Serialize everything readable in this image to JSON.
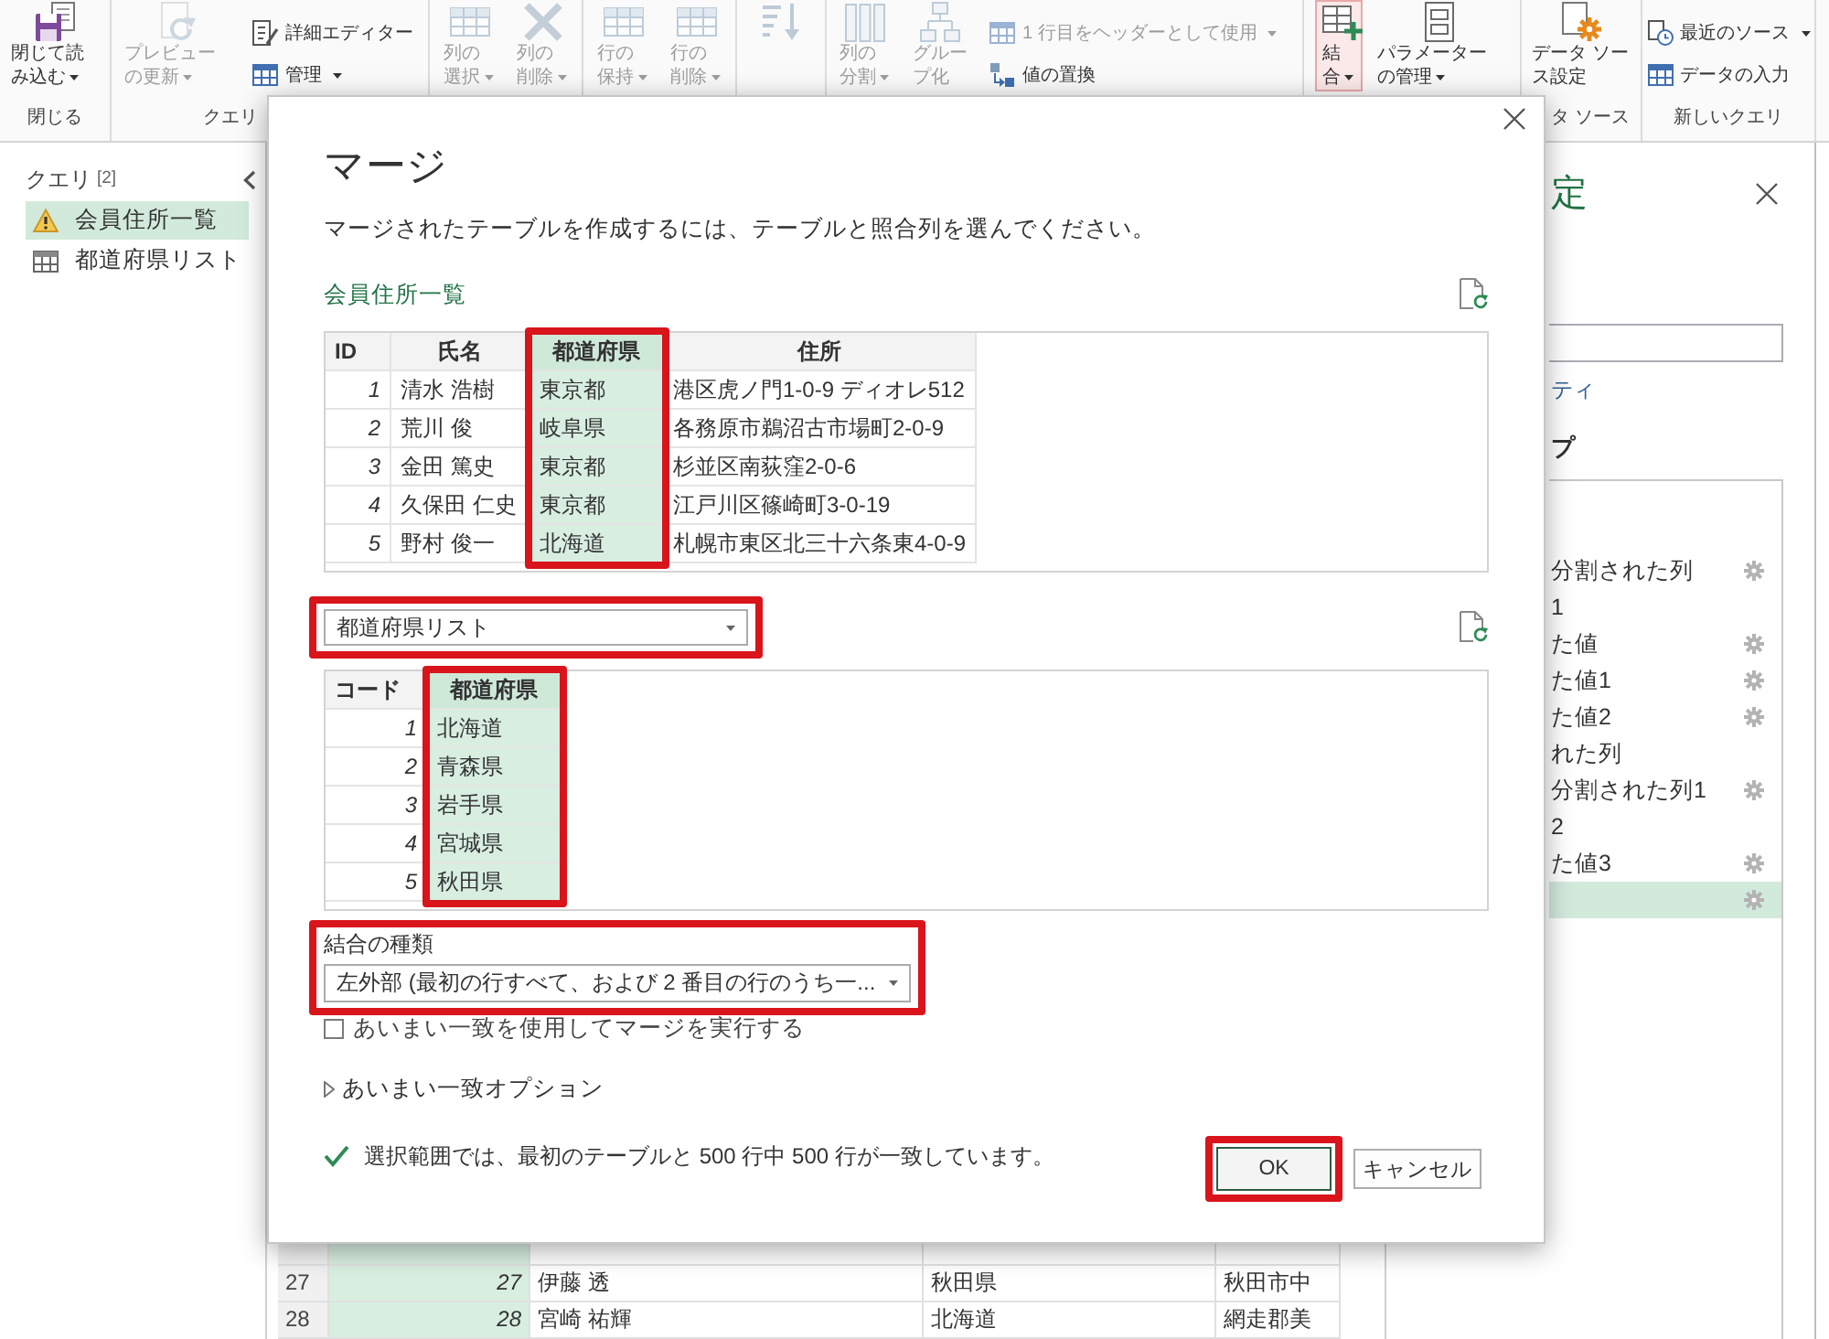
{
  "ribbon": {
    "groups": [
      {
        "label": "閉じる",
        "buttons": [
          {
            "kind": "large",
            "text": "閉じて読み込む",
            "caret": true,
            "disabled": false,
            "pressed": false
          }
        ]
      },
      {
        "label": "クエリ",
        "buttons": [
          {
            "kind": "large",
            "text": "プレビューの更新",
            "caret": true,
            "disabled": true,
            "pressed": false
          },
          {
            "kind": "small",
            "text": "詳細エディター",
            "caret": false,
            "disabled": false,
            "pressed": false
          },
          {
            "kind": "small",
            "text": "管理",
            "caret": true,
            "disabled": false,
            "pressed": false
          }
        ]
      },
      {
        "buttons": [
          {
            "kind": "large",
            "text": "列の選択",
            "caret": true,
            "disabled": true,
            "pressed": false
          },
          {
            "kind": "large",
            "text": "列の削除",
            "caret": true,
            "disabled": true,
            "pressed": false
          }
        ]
      },
      {
        "buttons": [
          {
            "kind": "large",
            "text": "行の保持",
            "caret": true,
            "disabled": true,
            "pressed": false
          },
          {
            "kind": "large",
            "text": "行の削除",
            "caret": true,
            "disabled": true,
            "pressed": false
          }
        ]
      },
      {
        "buttons": [
          {
            "kind": "icon",
            "caret": false,
            "disabled": true,
            "pressed": false
          }
        ]
      },
      {
        "buttons": [
          {
            "kind": "large",
            "text": "列の分割",
            "caret": true,
            "disabled": true,
            "pressed": false
          },
          {
            "kind": "large",
            "text": "グループ化",
            "caret": false,
            "disabled": true,
            "pressed": false
          },
          {
            "kind": "small",
            "text": "1 行目をヘッダーとして使用",
            "caret": true,
            "disabled": true,
            "pressed": false
          },
          {
            "kind": "small",
            "text": "値の置換",
            "caret": false,
            "disabled": false,
            "pressed": false
          }
        ]
      },
      {
        "buttons": [
          {
            "kind": "large",
            "text": "結合",
            "caret": true,
            "disabled": false,
            "pressed": true
          },
          {
            "kind": "large",
            "text": "パラメーターの管理",
            "caret": true,
            "disabled": false,
            "pressed": false
          }
        ]
      },
      {
        "label": "タ ソース",
        "buttons": [
          {
            "kind": "large",
            "text": "データ ソース設定",
            "caret": false,
            "disabled": false,
            "pressed": false
          }
        ]
      },
      {
        "label": "新しいクエリ",
        "buttons": [
          {
            "kind": "small",
            "text": "最近のソース",
            "caret": true,
            "disabled": false,
            "pressed": false
          },
          {
            "kind": "small",
            "text": "データの入力",
            "caret": false,
            "disabled": false,
            "pressed": false
          }
        ]
      }
    ]
  },
  "queries": {
    "title": "クエリ",
    "count": "[2]",
    "items": [
      {
        "name": "会員住所一覧",
        "kind": "warning",
        "selected": true
      },
      {
        "name": "都道府県リスト",
        "kind": "table",
        "selected": false
      }
    ]
  },
  "dialog": {
    "title": "マージ",
    "description": "マージされたテーブルを作成するには、テーブルと照合列を選んでください。",
    "first_table": {
      "name": "会員住所一覧",
      "columns": [
        {
          "label": "ID",
          "kind": "number",
          "selected": false,
          "highlighted": false
        },
        {
          "label": "氏名",
          "kind": "text",
          "selected": false,
          "highlighted": false
        },
        {
          "label": "都道府県",
          "kind": "text",
          "selected": true,
          "highlighted": true
        },
        {
          "label": "住所",
          "kind": "text",
          "selected": false,
          "highlighted": false
        }
      ],
      "rows": [
        [
          "1",
          "清水 浩樹",
          "東京都",
          "港区虎ノ門1-0-9 ディオレ512"
        ],
        [
          "2",
          "荒川 俊",
          "岐阜県",
          "各務原市鵜沼古市場町2-0-9"
        ],
        [
          "3",
          "金田 篤史",
          "東京都",
          "杉並区南荻窪2-0-6"
        ],
        [
          "4",
          "久保田 仁史",
          "東京都",
          "江戸川区篠崎町3-0-19"
        ],
        [
          "5",
          "野村 俊一",
          "北海道",
          "札幌市東区北三十六条東4-0-9"
        ]
      ]
    },
    "second_table": {
      "select": {
        "value": "都道府県リスト",
        "highlighted": true
      },
      "columns": [
        {
          "label": "コード",
          "kind": "number",
          "selected": false,
          "highlighted": false
        },
        {
          "label": "都道府県",
          "kind": "text",
          "selected": true,
          "highlighted": true
        }
      ],
      "rows": [
        [
          "1",
          "北海道"
        ],
        [
          "2",
          "青森県"
        ],
        [
          "3",
          "岩手県"
        ],
        [
          "4",
          "宮城県"
        ],
        [
          "5",
          "秋田県"
        ]
      ]
    },
    "join_kind": {
      "label": "結合の種類",
      "value": "左外部 (最初の行すべて、および 2 番目の行のうち一...",
      "highlighted": true
    },
    "fuzzy_match": {
      "label": "あいまい一致を使用してマージを実行する",
      "checked": false
    },
    "fuzzy_options": {
      "label": "あいまい一致オプション",
      "expanded": false
    },
    "status": {
      "text": "選択範囲では、最初のテーブルと 500 行中 500 行が一致しています。",
      "ok": true
    },
    "buttons": [
      {
        "label": "OK",
        "default": true,
        "highlighted": true
      },
      {
        "label": "キャンセル",
        "default": false,
        "highlighted": false
      }
    ]
  },
  "settings_panel": {
    "title": "定",
    "link": "ティ",
    "section": "プ",
    "steps": [
      {
        "label": "分割された列",
        "gear": true,
        "selected": false
      },
      {
        "label": "1",
        "gear": false,
        "selected": false
      },
      {
        "label": "た値",
        "gear": true,
        "selected": false
      },
      {
        "label": "た値1",
        "gear": true,
        "selected": false
      },
      {
        "label": "た値2",
        "gear": true,
        "selected": false
      },
      {
        "label": "れた列",
        "gear": false,
        "selected": false
      },
      {
        "label": "分割された列1",
        "gear": true,
        "selected": false
      },
      {
        "label": "2",
        "gear": false,
        "selected": false
      },
      {
        "label": "た値3",
        "gear": true,
        "selected": false
      },
      {
        "gear": true,
        "selected": true
      }
    ]
  },
  "grid": {
    "columns": [
      {
        "kind": "number",
        "selected": true
      },
      {
        "kind": "text",
        "selected": false
      },
      {
        "kind": "text",
        "selected": false
      },
      {
        "kind": "text",
        "selected": false
      }
    ],
    "rows": [
      {
        "number": "27",
        "cells": [
          "27",
          "伊藤 透",
          "秋田県",
          "秋田市中"
        ]
      },
      {
        "number": "28",
        "cells": [
          "28",
          "宮崎 祐輝",
          "北海道",
          "網走郡美"
        ]
      }
    ]
  }
}
